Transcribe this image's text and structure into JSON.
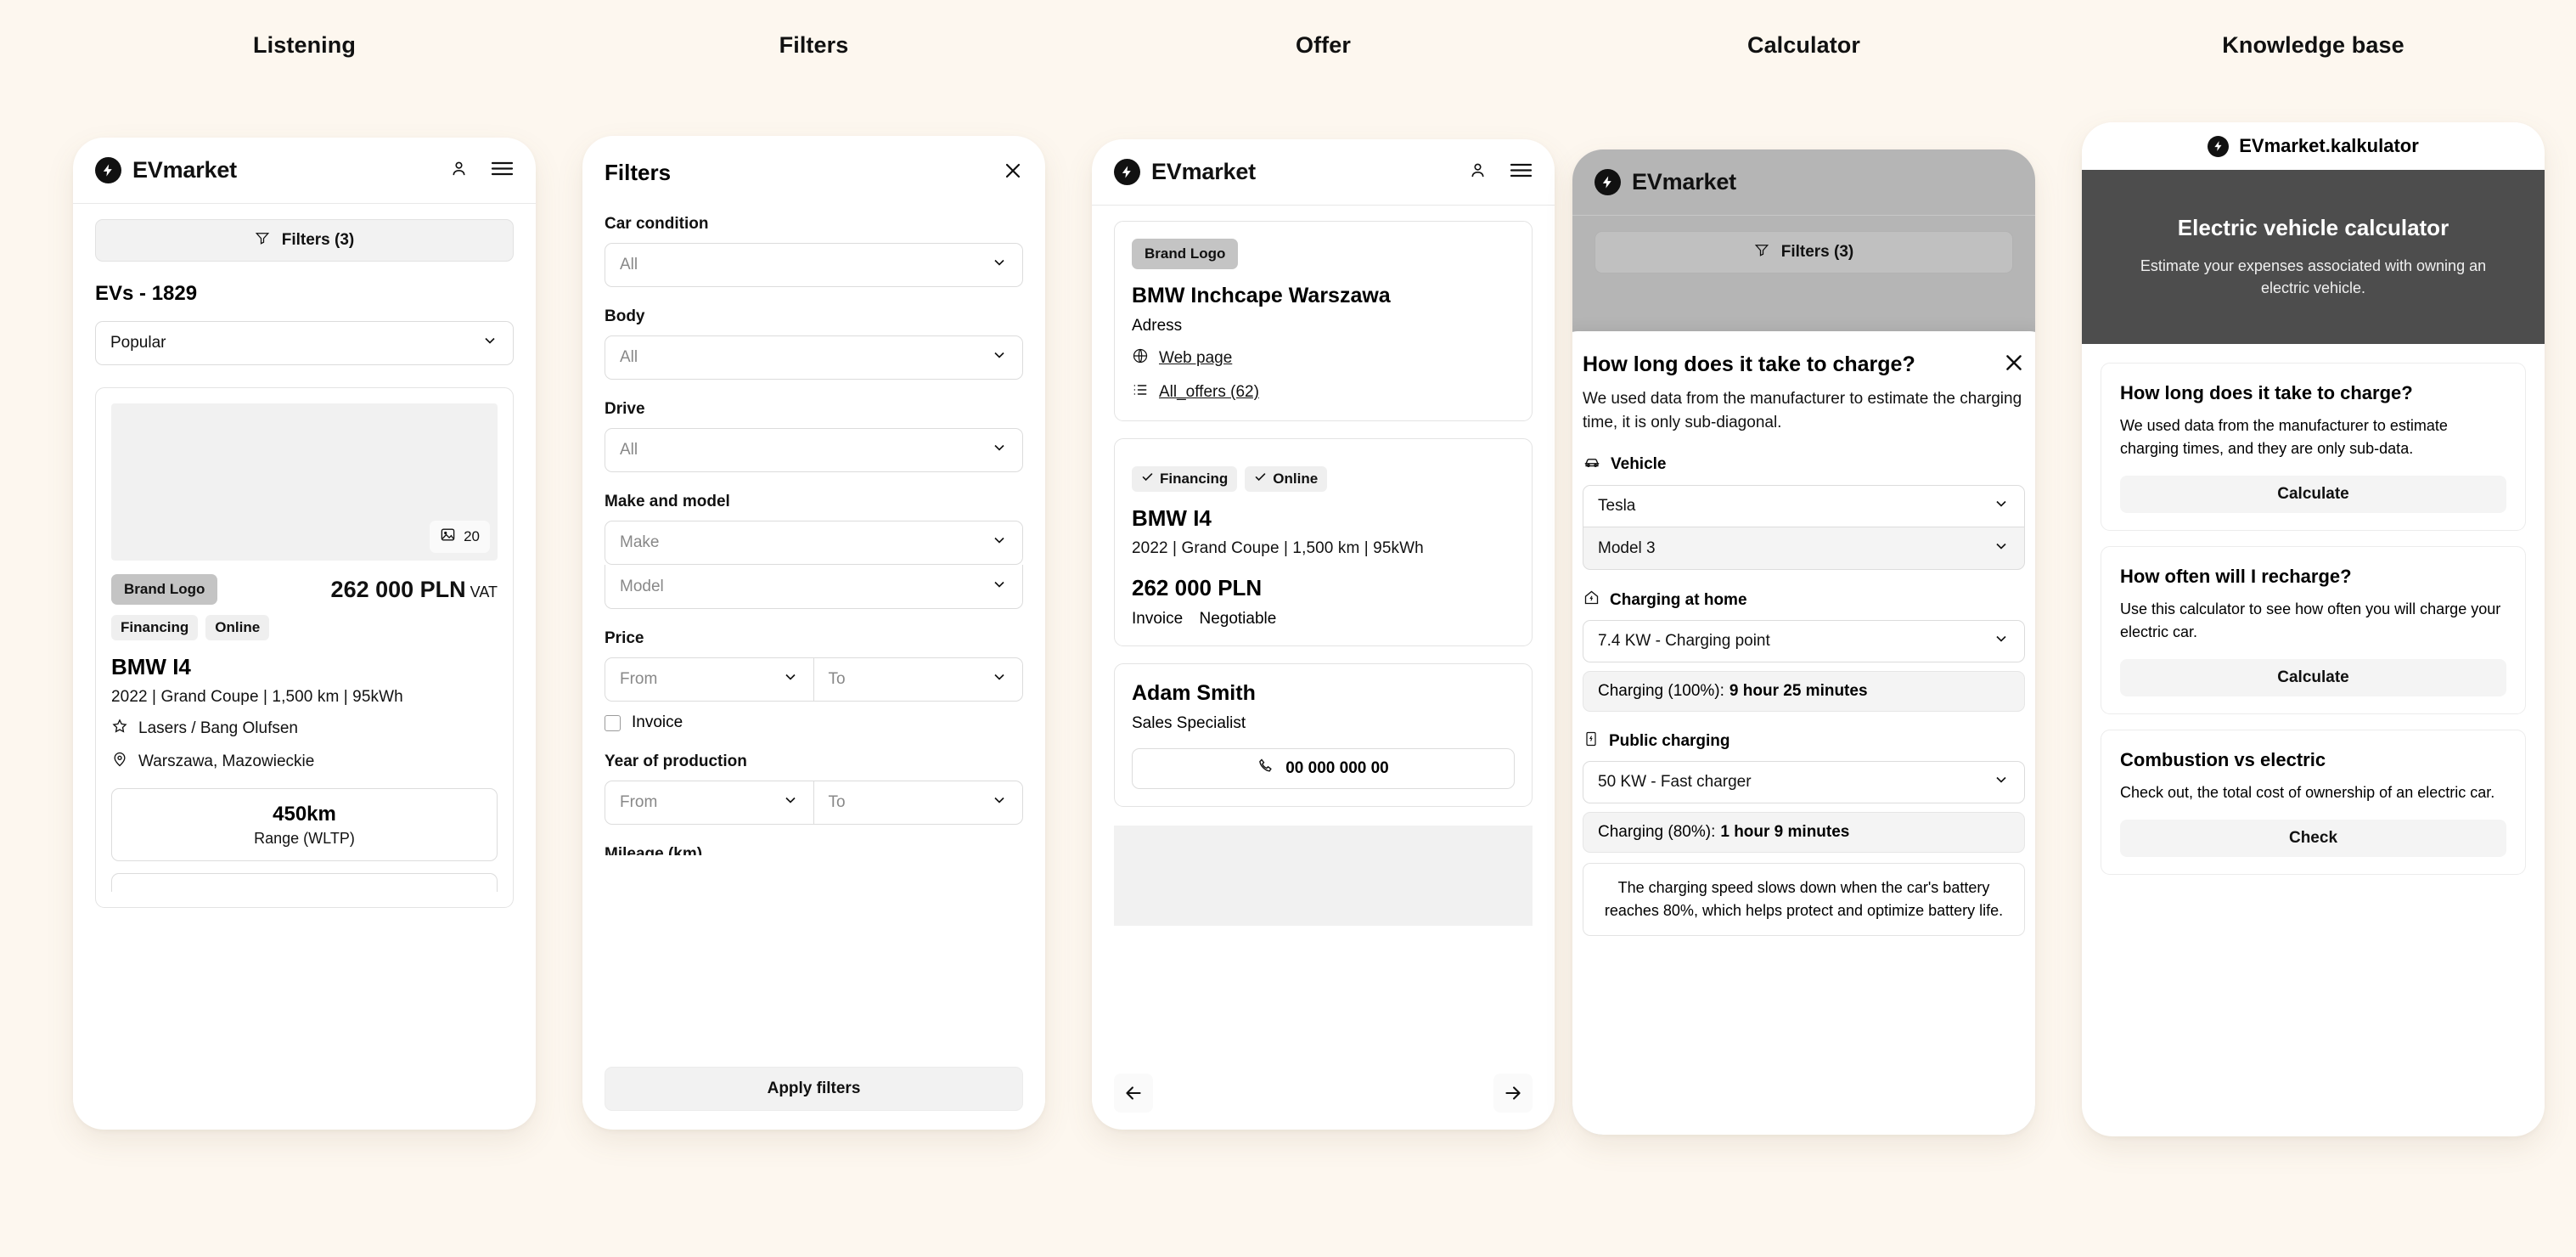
{
  "theme": {
    "background": "#fdf7ef",
    "panel": "#ffffff",
    "text": "#111111",
    "muted": "#888888",
    "chip_bg": "#efefef",
    "hero_bg": "#4d4d4d",
    "dim_bg": "#b5b5b5"
  },
  "columns": [
    {
      "title": "Listening"
    },
    {
      "title": "Filters"
    },
    {
      "title": "Offer"
    },
    {
      "title": "Calculator"
    },
    {
      "title": "Knowledge base"
    }
  ],
  "brand": {
    "name": "EVmarket",
    "icon": "bolt-icon"
  },
  "listening": {
    "appbar": {
      "brand": "EVmarket",
      "account_icon": "user-icon",
      "menu_icon": "hamburger-icon"
    },
    "filters_button": {
      "label": "Filters (3)",
      "icon": "funnel-icon"
    },
    "count_label": "EVs - 1829",
    "sort": {
      "value": "Popular",
      "icon": "chevron-down-icon"
    },
    "card": {
      "photo_count": "20",
      "photo_icon": "image-icon",
      "brand_logo": "Brand Logo",
      "price": "262 000 PLN",
      "price_suffix": "VAT",
      "chips": [
        "Financing",
        "Online"
      ],
      "title": "BMW I4",
      "specs": "2022   |   Grand Coupe   |   1,500 km   |   95kWh",
      "features": [
        {
          "icon": "star-icon",
          "text": "Lasers / Bang Olufsen"
        },
        {
          "icon": "pin-icon",
          "text": "Warszawa, Mazowieckie"
        }
      ],
      "range_value": "450km",
      "range_label": "Range (WLTP)"
    }
  },
  "filters": {
    "title": "Filters",
    "close_icon": "close-icon",
    "groups": [
      {
        "label": "Car condition",
        "fields": [
          {
            "value": "All",
            "placeholder": false
          }
        ]
      },
      {
        "label": "Body",
        "fields": [
          {
            "value": "All",
            "placeholder": false
          }
        ]
      },
      {
        "label": "Drive",
        "fields": [
          {
            "value": "All",
            "placeholder": false
          }
        ]
      },
      {
        "label": "Make and model",
        "fields": [
          {
            "value": "Make",
            "placeholder": true
          },
          {
            "value": "Model",
            "placeholder": true
          }
        ]
      }
    ],
    "price": {
      "label": "Price",
      "from": "From",
      "to": "To",
      "checkbox_label": "Invoice",
      "checked": false
    },
    "year": {
      "label": "Year of production",
      "from": "From",
      "to": "To"
    },
    "cut_off_label": "Mileage (km)",
    "apply_label": "Apply filters"
  },
  "offer": {
    "appbar": {
      "brand": "EVmarket",
      "account_icon": "user-icon",
      "menu_icon": "hamburger-icon"
    },
    "dealer": {
      "brand_logo": "Brand Logo",
      "name": "BMW Inchcape Warszawa",
      "address": "Adress",
      "links": [
        {
          "icon": "globe-icon",
          "text": "Web page"
        },
        {
          "icon": "list-icon",
          "text": "All_offers (62)"
        }
      ]
    },
    "listing": {
      "chips": [
        "Financing",
        "Online"
      ],
      "chip_icon": "check-icon",
      "title": "BMW I4",
      "specs": "2022   |   Grand Coupe   |   1,500 km   |   95kWh",
      "price": "262 000 PLN",
      "meta": [
        "Invoice",
        "Negotiable"
      ]
    },
    "seller": {
      "name": "Adam Smith",
      "role": "Sales Specialist",
      "phone": "00 000 000 00",
      "phone_icon": "phone-icon"
    },
    "nav": {
      "prev_icon": "arrow-left-icon",
      "next_icon": "arrow-right-icon"
    }
  },
  "calculator": {
    "appbar": {
      "brand": "EVmarket"
    },
    "filters_button": {
      "label": "Filters (3)",
      "icon": "funnel-icon"
    },
    "modal": {
      "title": "How long does it take to charge?",
      "close_icon": "close-icon",
      "subtitle": "We used data from the manufacturer to estimate the charging time, it is only sub-diagonal.",
      "vehicle": {
        "section_label": "Vehicle",
        "section_icon": "car-icon",
        "make": "Tesla",
        "model": "Model 3"
      },
      "home": {
        "section_label": "Charging at home",
        "section_icon": "home-charge-icon",
        "charger": "7.4 KW - Charging point",
        "result_prefix": "Charging (100%):",
        "result_value": "9 hour 25 minutes"
      },
      "public": {
        "section_label": "Public charging",
        "section_icon": "charging-station-icon",
        "charger": "50 KW -  Fast charger",
        "result_prefix": "Charging (80%):",
        "result_value": "1 hour 9 minutes"
      },
      "note": "The charging speed slows down when the car's battery reaches 80%, which helps protect and optimize battery life."
    }
  },
  "knowledge_base": {
    "appbar_title": "EVmarket.kalkulator",
    "hero": {
      "title": "Electric vehicle calculator",
      "subtitle": "Estimate your expenses associated with owning an electric vehicle."
    },
    "cards": [
      {
        "title": "How long does it take to charge?",
        "desc": "We used data from the manufacturer to estimate charging times, and they are only sub-data.",
        "button": "Calculate"
      },
      {
        "title": "How often will I recharge?",
        "desc": "Use this calculator to see how often you will charge your electric car.",
        "button": "Calculate"
      },
      {
        "title": "Combustion vs electric",
        "desc": "Check out, the total cost of ownership of an electric car.",
        "button": "Check"
      }
    ]
  }
}
